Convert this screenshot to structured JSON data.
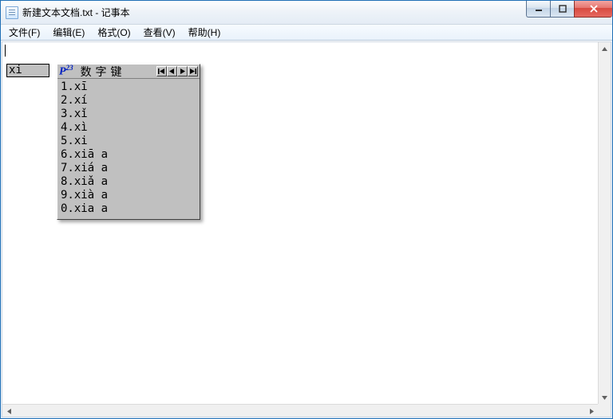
{
  "window": {
    "title": "新建文本文档.txt - 记事本"
  },
  "menu": {
    "file": "文件(F)",
    "edit": "编辑(E)",
    "format": "格式(O)",
    "view": "查看(V)",
    "help": "帮助(H)"
  },
  "editor": {
    "content": ""
  },
  "ime": {
    "composition": "xi",
    "logo": "P",
    "logo_sup": "23",
    "title": "数字键",
    "candidates": [
      {
        "idx": "1",
        "text": "xī"
      },
      {
        "idx": "2",
        "text": "xí"
      },
      {
        "idx": "3",
        "text": "xǐ"
      },
      {
        "idx": "4",
        "text": "xì"
      },
      {
        "idx": "5",
        "text": "xi"
      },
      {
        "idx": "6",
        "text": "xiā a"
      },
      {
        "idx": "7",
        "text": "xiá a"
      },
      {
        "idx": "8",
        "text": "xiǎ a"
      },
      {
        "idx": "9",
        "text": "xià a"
      },
      {
        "idx": "0",
        "text": "xia a"
      }
    ]
  }
}
